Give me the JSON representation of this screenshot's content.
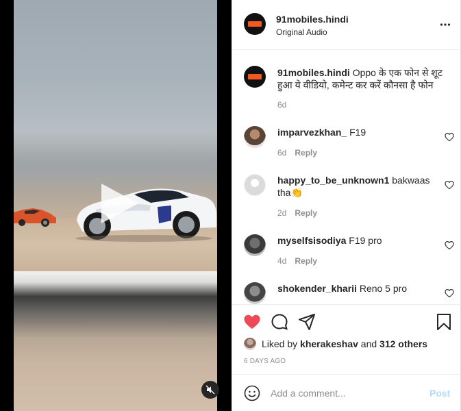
{
  "post": {
    "username": "91mobiles.hindi",
    "audio": "Original Audio",
    "caption": {
      "username": "91mobiles.hindi",
      "text": "Oppo के एक फोन से शूट हुआ ये वीडियो, कमेन्ट कर करें कौनसा है फोन",
      "time": "6d"
    }
  },
  "comments": [
    {
      "username": "imparvezkhan_",
      "text": "F19",
      "time": "6d",
      "reply": "Reply"
    },
    {
      "username": "happy_to_be_unknown1",
      "text": "bakwaas tha👏",
      "time": "2d",
      "reply": "Reply"
    },
    {
      "username": "myselfsisodiya",
      "text": "F19 pro",
      "time": "4d",
      "reply": "Reply"
    },
    {
      "username": "shokender_kharii",
      "text": "Reno 5 pro",
      "time": "",
      "reply": ""
    }
  ],
  "likes": {
    "prefix": "Liked by",
    "user": "kherakeshav",
    "and": "and",
    "others": "312 others"
  },
  "timeago": "6 DAYS AGO",
  "composer": {
    "placeholder": "Add a comment...",
    "post_label": "Post"
  },
  "colors": {
    "heart_liked": "#ed4956",
    "post_disabled": "#b3dbff",
    "muted_text": "#8e8e8e"
  }
}
